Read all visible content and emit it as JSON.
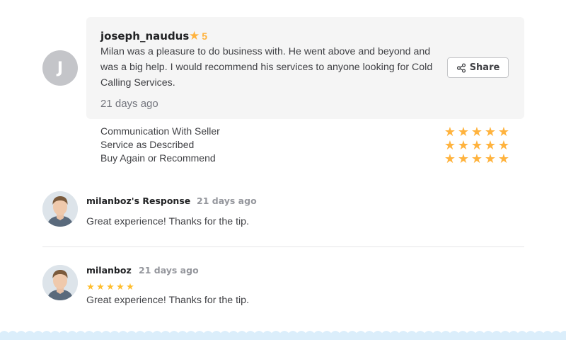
{
  "review": {
    "avatar_letter": "J",
    "reviewer_name": "joseph_naudus",
    "rating": "5",
    "text": "Milan was a pleasure to do business with. He went above and beyond and was a big help. I would recommend his services to anyone looking for Cold Calling Services.",
    "date": "21 days ago",
    "share_label": "Share"
  },
  "breakdown": [
    {
      "label": "Communication With Seller",
      "stars": 5
    },
    {
      "label": "Service as Described",
      "stars": 5
    },
    {
      "label": "Buy Again or Recommend",
      "stars": 5
    }
  ],
  "seller_response": {
    "name": "milanboz's Response",
    "date": "21 days ago",
    "text": "Great experience! Thanks for the tip."
  },
  "seller_review": {
    "name": "milanboz",
    "date": "21 days ago",
    "stars": 5,
    "text": "Great experience! Thanks for the tip."
  },
  "colors": {
    "star": "#ffb33e",
    "card_bg": "#f5f5f5",
    "footer_wave": "#dbeefb"
  }
}
